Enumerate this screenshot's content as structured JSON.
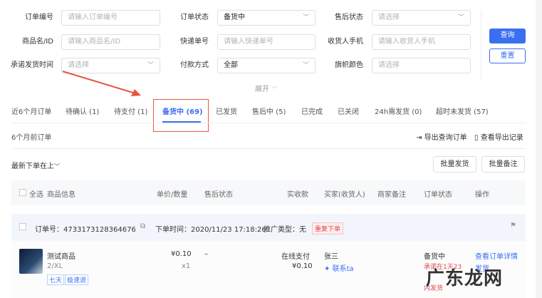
{
  "filters": {
    "order_no": {
      "label": "订单编号",
      "placeholder": "请输入订单编号"
    },
    "order_status": {
      "label": "订单状态",
      "value": "备货中"
    },
    "aftersale_status": {
      "label": "售后状态",
      "placeholder": "请选择"
    },
    "product": {
      "label": "商品名/ID",
      "placeholder": "请输入商品名/ID"
    },
    "express_no": {
      "label": "快递单号",
      "placeholder": "请输入快递单号"
    },
    "receiver_phone": {
      "label": "收货人手机",
      "placeholder": "请输入收货人手机"
    },
    "promise_time": {
      "label": "承诺发货时间",
      "placeholder": "请选择"
    },
    "pay_method": {
      "label": "付款方式",
      "value": "全部"
    },
    "flag_color": {
      "label": "旗帜颜色",
      "placeholder": "请选择"
    },
    "expand": "展开",
    "search_button": "查询",
    "reset_button": "重置"
  },
  "tabs": [
    {
      "label": "近6个月订单"
    },
    {
      "label": "待确认 (1)"
    },
    {
      "label": "待支付 (1)"
    },
    {
      "label": "备货中 (69)",
      "active": true
    },
    {
      "label": "已发货"
    },
    {
      "label": "售后中 (5)"
    },
    {
      "label": "已完成"
    },
    {
      "label": "已关闭"
    },
    {
      "label": "24h需发货 (0)"
    },
    {
      "label": "超时未发货 (57)"
    }
  ],
  "toolbar": {
    "older_orders": "6个月前订单",
    "export": "导出查询订单",
    "view_exports": "查看导出记录",
    "sort": "最新下单在上",
    "batch_ship": "批量发货",
    "batch_note": "批量备注"
  },
  "table": {
    "select_all": "全选",
    "columns": [
      "商品信息",
      "单价/数量",
      "售后状态",
      "实收款",
      "买家(收货人)",
      "商家备注",
      "订单状态",
      "操作"
    ]
  },
  "order": {
    "order_no": "订单号：4733173128364676",
    "order_time": "下单时间：2020/11/23 17:18:26",
    "promo_type": "推广类型：无",
    "repeat_tag": "重复下单",
    "product_name": "测试商品",
    "sku": "2/XL",
    "tags": [
      "七天",
      "极速退"
    ],
    "price": "¥0.10",
    "qty": "x1",
    "aftersale": "–",
    "pay_type": "在线支付",
    "paid": "¥0.10",
    "buyer": "张三",
    "contact": "联系ta",
    "status": "备货中",
    "promise_line1": "承诺在1天23",
    "promise_line2": "内发货",
    "view_detail": "查看订单详情",
    "ship": "发货"
  },
  "watermark": "广东龙网"
}
